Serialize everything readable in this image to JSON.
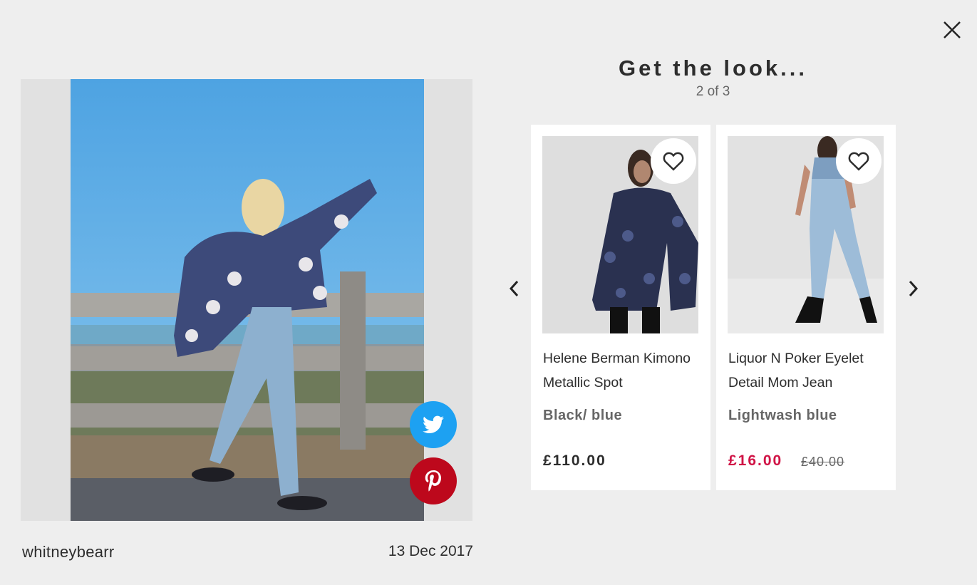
{
  "modal": {
    "close_icon": "close-icon"
  },
  "post": {
    "username": "whitneybearr",
    "date": "13 Dec 2017",
    "share": {
      "twitter_icon": "twitter-icon",
      "twitter_color": "#1da1f2",
      "pinterest_icon": "pinterest-icon",
      "pinterest_color": "#bd081c"
    }
  },
  "look": {
    "heading": "Get the look...",
    "pager": "2 of 3",
    "prev_icon": "chevron-left-icon",
    "next_icon": "chevron-right-icon",
    "products": [
      {
        "name": "Helene Berman Kimono Metallic Spot",
        "colour": "Black/ blue",
        "price": "£110.00",
        "was_price": ""
      },
      {
        "name": "Liquor N Poker Eyelet Detail Mom Jean",
        "colour": "Lightwash blue",
        "price": "£16.00",
        "was_price": "£40.00",
        "sale_color": "#d01345"
      }
    ]
  }
}
